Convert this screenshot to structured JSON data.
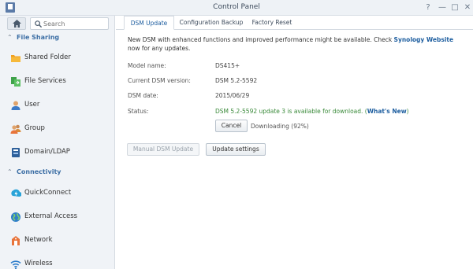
{
  "window": {
    "title": "Control Panel",
    "controls": [
      "?",
      "—",
      "□",
      "✕"
    ]
  },
  "sidebar": {
    "search": {
      "placeholder": "Search"
    },
    "sections": [
      {
        "label": "File Sharing"
      },
      {
        "label": "Connectivity"
      }
    ],
    "items": [
      {
        "label": "Shared Folder",
        "icon": "shared-folder-icon"
      },
      {
        "label": "File Services",
        "icon": "file-services-icon"
      },
      {
        "label": "User",
        "icon": "user-icon"
      },
      {
        "label": "Group",
        "icon": "group-icon"
      },
      {
        "label": "Domain/LDAP",
        "icon": "domain-icon"
      },
      {
        "label": "QuickConnect",
        "icon": "quickconnect-icon"
      },
      {
        "label": "External Access",
        "icon": "globe-icon"
      },
      {
        "label": "Network",
        "icon": "network-icon"
      },
      {
        "label": "Wireless",
        "icon": "wireless-icon"
      }
    ]
  },
  "tabs": [
    {
      "label": "DSM Update",
      "active": true
    },
    {
      "label": "Configuration Backup",
      "active": false
    },
    {
      "label": "Factory Reset",
      "active": false
    }
  ],
  "update": {
    "notice_text": "New DSM with enhanced functions and improved performance might be available. Check ",
    "notice_link": "Synology Website",
    "notice_tail": " now for any updates.",
    "rows": [
      {
        "label": "Model name:",
        "value": "DS415+"
      },
      {
        "label": "Current DSM version:",
        "value": "DSM 5.2-5592"
      },
      {
        "label": "DSM date:",
        "value": "2015/06/29"
      }
    ],
    "status_label": "Status:",
    "status_text": "DSM 5.2-5592 update 3 is available for download. (",
    "status_link": "What's New",
    "status_close": ")",
    "cancel_label": "Cancel",
    "progress_text": "Downloading (92%)",
    "progress_percent": 92,
    "manual_update_label": "Manual DSM Update",
    "update_settings_label": "Update settings"
  },
  "colors": {
    "accent": "#1f5fa0",
    "status_green": "#3a8a3a",
    "sidebar_bg": "#f0f3f7"
  }
}
